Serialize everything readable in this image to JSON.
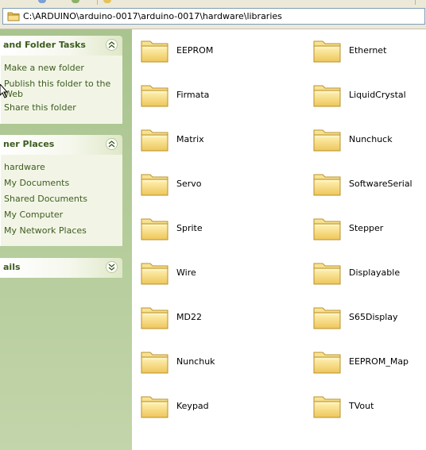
{
  "address": {
    "path": "C:\\ARDUINO\\arduino-0017\\arduino-0017\\hardware\\libraries",
    "icon": "folder-icon"
  },
  "taskpane": {
    "file_tasks": {
      "title": "and Folder Tasks",
      "links": [
        "Make a new folder",
        "Publish this folder to the Web",
        "Share this folder"
      ]
    },
    "other_places": {
      "title": "ner Places",
      "links": [
        "hardware",
        "My Documents",
        "Shared Documents",
        "My Computer",
        "My Network Places"
      ]
    },
    "details": {
      "title": "ails"
    }
  },
  "colors": {
    "link": "#3d5c1f",
    "pane_bg": "#b6cd9c",
    "folder": "#f2d36b"
  },
  "folders": [
    {
      "name": "EEPROM"
    },
    {
      "name": "Ethernet"
    },
    {
      "name": "Firmata"
    },
    {
      "name": "LiquidCrystal"
    },
    {
      "name": "Matrix"
    },
    {
      "name": "Nunchuck"
    },
    {
      "name": "Servo"
    },
    {
      "name": "SoftwareSerial"
    },
    {
      "name": "Sprite"
    },
    {
      "name": "Stepper"
    },
    {
      "name": "Wire"
    },
    {
      "name": "Displayable"
    },
    {
      "name": "MD22"
    },
    {
      "name": "S65Display"
    },
    {
      "name": "Nunchuk"
    },
    {
      "name": "EEPROM_Map"
    },
    {
      "name": "Keypad"
    },
    {
      "name": "TVout"
    }
  ]
}
